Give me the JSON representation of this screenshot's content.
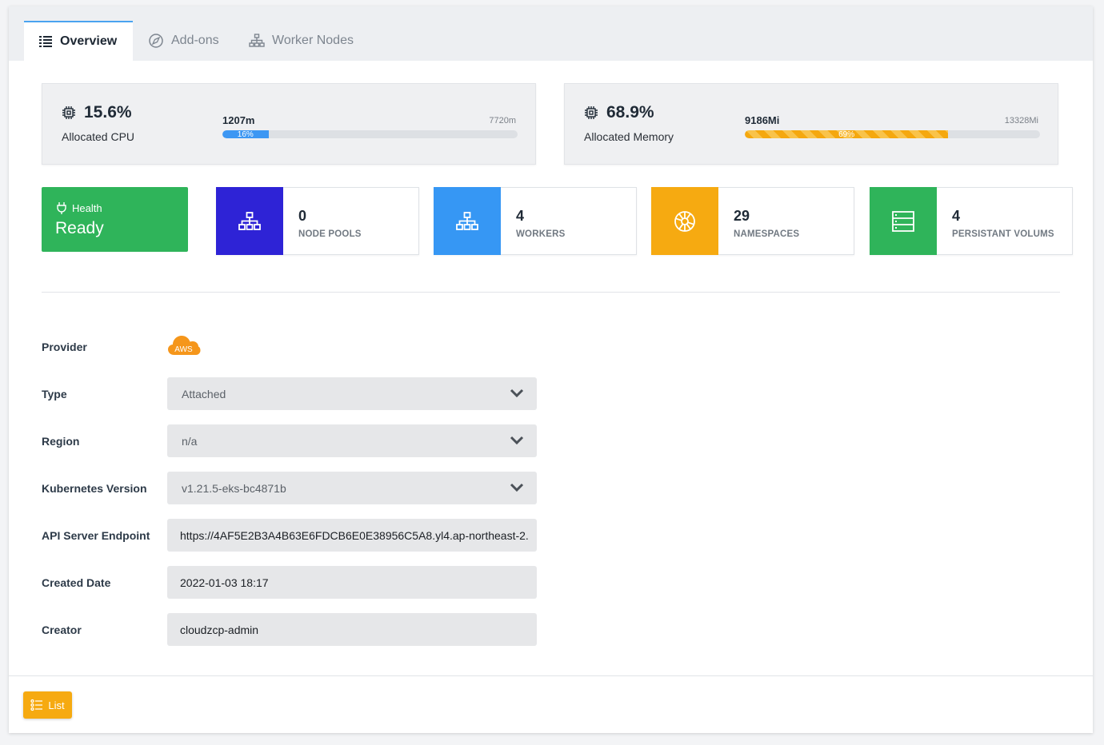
{
  "tabs": [
    {
      "label": "Overview",
      "icon": "list-icon",
      "active": true
    },
    {
      "label": "Add-ons",
      "icon": "compass-icon",
      "active": false
    },
    {
      "label": "Worker Nodes",
      "icon": "sitemap-icon",
      "active": false
    }
  ],
  "cpu": {
    "percent": "15.6%",
    "label": "Allocated CPU",
    "used": "1207m",
    "total": "7720m",
    "bar_fraction": 0.156,
    "bar_text": "16%",
    "color": "#3d97f3"
  },
  "memory": {
    "percent": "68.9%",
    "label": "Allocated Memory",
    "used": "9186Mi",
    "total": "13328Mi",
    "bar_fraction": 0.689,
    "bar_text": "69%",
    "color": "#f5a80f"
  },
  "health": {
    "label": "Health",
    "status": "Ready",
    "color": "#2fb45a"
  },
  "tiles": [
    {
      "value": "0",
      "label": "NODE POOLS",
      "icon": "sitemap-icon",
      "color": "#2e23d6"
    },
    {
      "value": "4",
      "label": "WORKERS",
      "icon": "sitemap-icon",
      "color": "#3697f4"
    },
    {
      "value": "29",
      "label": "NAMESPACES",
      "icon": "helm-icon",
      "color": "#f6aa11"
    },
    {
      "value": "4",
      "label": "PERSISTANT VOLUMS",
      "icon": "storage-icon",
      "color": "#2fb45a"
    }
  ],
  "form": {
    "provider_label": "Provider",
    "provider_logo_text": "AWS",
    "type_label": "Type",
    "type_value": "Attached",
    "region_label": "Region",
    "region_value": "n/a",
    "k8s_label": "Kubernetes Version",
    "k8s_value": "v1.21.5-eks-bc4871b",
    "api_label": "API Server Endpoint",
    "api_value": "https://4AF5E2B3A4B63E6FDCB6E0E38956C5A8.yl4.ap-northeast-2.",
    "created_label": "Created Date",
    "created_value": "2022-01-03 18:17",
    "creator_label": "Creator",
    "creator_value": "cloudzcp-admin"
  },
  "footer": {
    "list_button": "List"
  }
}
